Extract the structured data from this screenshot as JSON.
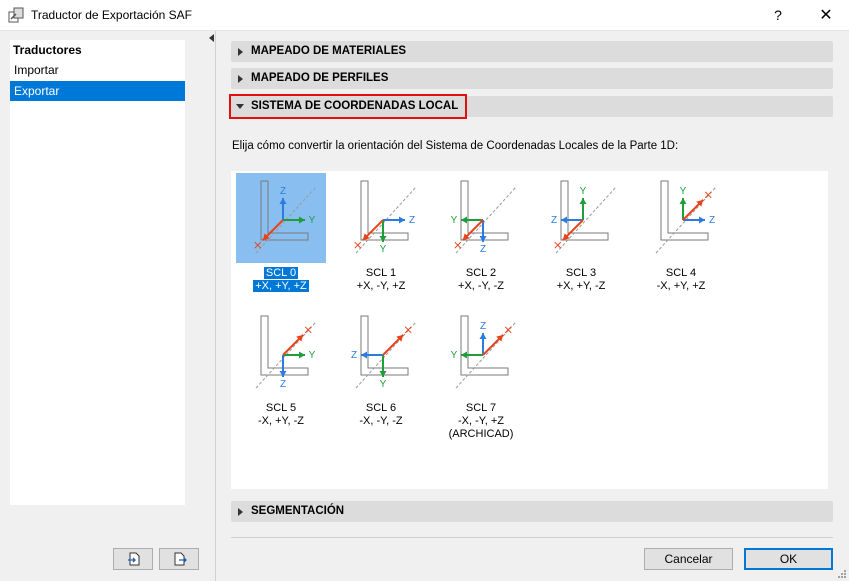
{
  "window": {
    "title": "Traductor de Exportación SAF",
    "help": "?",
    "close": "✕"
  },
  "sidebar": {
    "header": "Traductores",
    "items": [
      {
        "label": "Importar"
      },
      {
        "label": "Exportar",
        "selected": true
      }
    ]
  },
  "sections": {
    "materials": "MAPEADO DE MATERIALES",
    "profiles": "MAPEADO DE PERFILES",
    "lcs": "SISTEMA DE COORDENADAS LOCAL",
    "segmentation": "SEGMENTACIÓN"
  },
  "instruction": "Elija cómo convertir la orientación del Sistema de Coordenadas Locales de la Parte 1D:",
  "scl_options": [
    {
      "name": "SCL 0",
      "axes": "+X, +Y, +Z",
      "selected": true
    },
    {
      "name": "SCL 1",
      "axes": "+X, -Y, +Z"
    },
    {
      "name": "SCL 2",
      "axes": "+X, -Y, -Z"
    },
    {
      "name": "SCL 3",
      "axes": "+X, +Y, -Z"
    },
    {
      "name": "SCL 4",
      "axes": "-X, +Y, +Z"
    },
    {
      "name": "SCL 5",
      "axes": "-X, +Y, -Z"
    },
    {
      "name": "SCL 6",
      "axes": "-X, -Y, -Z"
    },
    {
      "name": "SCL 7",
      "axes": "-X, -Y, +Z",
      "note": "(ARCHICAD)"
    }
  ],
  "axis_letters": {
    "x": "X",
    "y": "Y",
    "z": "Z"
  },
  "colors": {
    "x_axis": "#e8421a",
    "y_axis": "#1e9e3a",
    "z_axis": "#2b7ce0",
    "selection": "#0078d7",
    "highlight": "#e01010"
  },
  "buttons": {
    "cancel": "Cancelar",
    "ok": "OK"
  }
}
